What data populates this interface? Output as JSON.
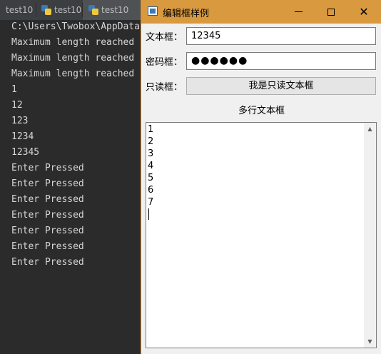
{
  "tabs": [
    {
      "label": "test10"
    },
    {
      "label": "test10"
    },
    {
      "label": "test10"
    }
  ],
  "console": {
    "lines": [
      "C:\\Users\\Twobox\\AppData",
      "Maximum length reached",
      "Maximum length reached",
      "Maximum length reached",
      "1",
      "12",
      "123",
      "1234",
      "12345",
      "Enter Pressed",
      "Enter Pressed",
      "Enter Pressed",
      "Enter Pressed",
      "Enter Pressed",
      "Enter Pressed",
      "Enter Pressed"
    ]
  },
  "window": {
    "title": "编辑框样例",
    "form": {
      "text_label": "文本框：",
      "text_value": "12345",
      "password_label": "密码框：",
      "password_value": "●●●●●●",
      "readonly_label": "只读框：",
      "readonly_value": "我是只读文本框",
      "multiline_label": "多行文本框",
      "multiline_lines": [
        "1",
        "2",
        "3",
        "4",
        "5",
        "6",
        "7"
      ]
    }
  },
  "colors": {
    "titlebar": "#d9993f",
    "console_bg": "#2b2b2b",
    "console_text": "#d6d6d6"
  }
}
